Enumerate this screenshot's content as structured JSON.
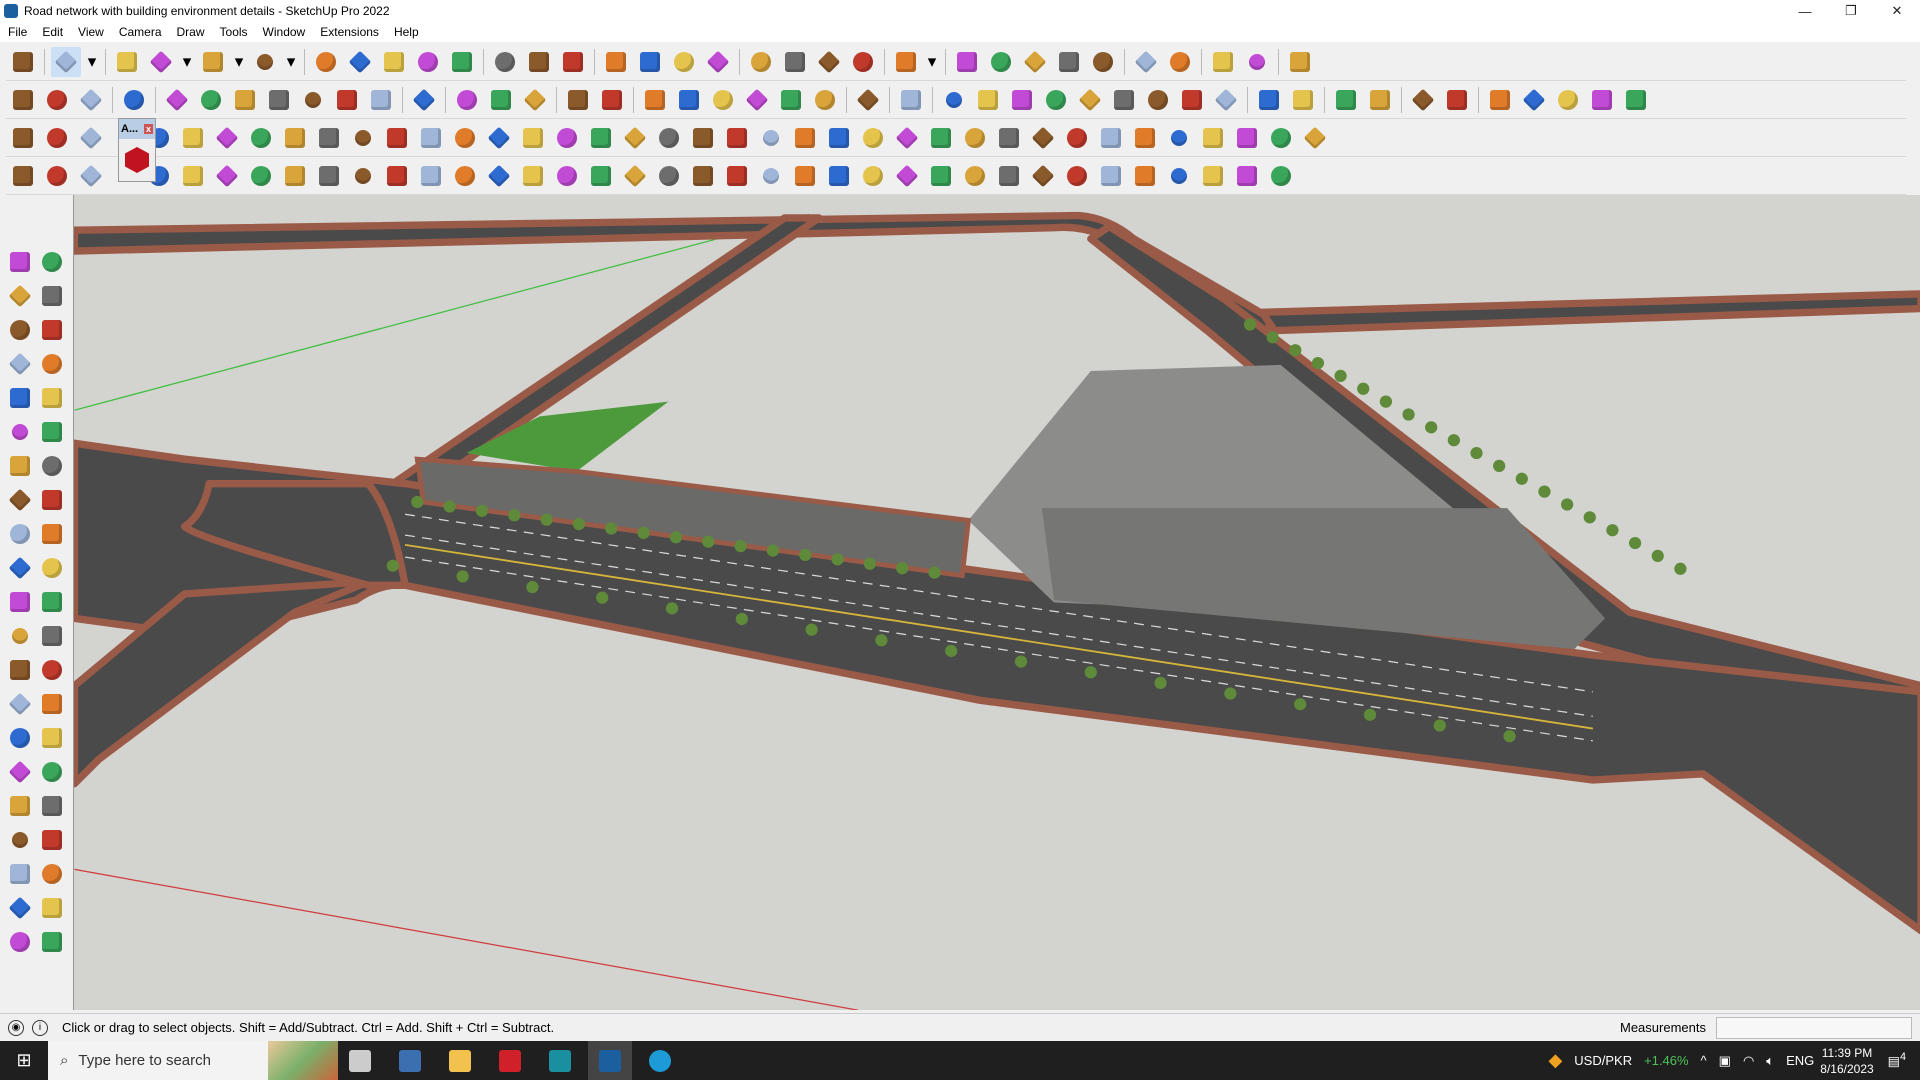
{
  "window": {
    "title": "Road network with building environment details - SketchUp Pro 2022",
    "controls": [
      "—",
      "❐",
      "✕"
    ]
  },
  "menu": [
    "File",
    "Edit",
    "View",
    "Camera",
    "Draw",
    "Tools",
    "Window",
    "Extensions",
    "Help"
  ],
  "toolbars": {
    "row1": [
      "zoom-icon",
      "|",
      "select-icon",
      "dropdown-icon",
      "|",
      "eraser-icon",
      "pencil-icon",
      "dropdown-icon",
      "arc-icon",
      "dropdown-icon",
      "rectangle-icon",
      "dropdown-icon",
      "|",
      "push-pull-icon",
      "follow-me-icon",
      "move-icon",
      "rotate-icon",
      "scale-icon",
      "|",
      "tape-measure-icon",
      "text-icon",
      "paint-bucket-icon",
      "|",
      "orbit-icon",
      "pan-icon",
      "zoom-tool-icon",
      "zoom-extents-icon",
      "|",
      "components-icon",
      "styles-icon",
      "layers-icon",
      "scenes-icon",
      "|",
      "user-icon",
      "dropdown-icon",
      "|",
      "export-icon",
      "import-icon",
      "up-icon",
      "sort-up-icon",
      "sort-down-icon",
      "|",
      "measure-icon",
      "section-icon",
      "|",
      "undo-icon",
      "redo-icon",
      "|",
      "hand-icon"
    ],
    "row2": [
      "solid-union-icon",
      "solid-trim-icon",
      "solid-split-icon",
      "|",
      "joint-pushpull-icon",
      "|",
      "pushpull-normal-icon",
      "pushpull-joint-icon",
      "pushpull-round-icon",
      "pushpull-vector-icon",
      "pushpull-n-icon",
      "pushpull-x-icon",
      "pushpull-f-icon",
      "|",
      "curviloft-icon",
      "|",
      "slice-icon",
      "slice-icon",
      "slice-icon",
      "|",
      "sandbox-icon",
      "sandbox-drape-icon",
      "|",
      "house-icon",
      "wall-icon",
      "home-icon",
      "roof-icon",
      "outline-house-icon",
      "garage-icon",
      "|",
      "function-icon",
      "|",
      "leaf-icon",
      "|",
      "ruler-icon",
      "rect-shape-icon",
      "circle-shape-icon",
      "hexagon-shape-icon",
      "ellipse-shape-icon",
      "parallelogram-shape-icon",
      "arc-shape-icon",
      "spiral-shape-icon",
      "polygon-shape-icon",
      "|",
      "loop-icon",
      "gear-icon",
      "|",
      "line-red-icon",
      "eraser-pink-icon",
      "|",
      "cube-brown-icon",
      "grid-brown-icon",
      "|",
      "brick-icon",
      "stone-icon",
      "round-icon",
      "block-icon",
      "box-icon"
    ],
    "row3": [
      "plane-hash-icon",
      "plane-blue-icon",
      "plane-yellow-icon",
      "gap",
      "grid-red-icon",
      "grid-outline-icon",
      "rotate-orange-icon",
      "square-red-icon",
      "columns-icon",
      "flag-icon",
      "wood-icon",
      "pipe-icon",
      "bend-icon",
      "points-icon",
      "cross-red-icon",
      "cross-green-icon",
      "x-blue-icon",
      "drop-icon",
      "drop-hash-icon",
      "triangle-icon",
      "loop-orange-icon",
      "loop-red-icon",
      "loop-black-icon",
      "star-icon",
      "bucket-icon",
      "magnet-icon",
      "tree-icon",
      "array-icon",
      "copy-icon",
      "duplicate-icon",
      "gem-icon",
      "flower-icon",
      "film-icon",
      "grid-orange-icon",
      "grid-yellow-icon",
      "grid-gold-icon",
      "scatter-icon",
      "curve-icon",
      "qr-icon"
    ],
    "row4": [
      "poly-icon",
      "dots-icon",
      "cube-red-icon",
      "gap",
      "sphere-icon",
      "box-outline-icon",
      "bend-shape-icon",
      "dome-icon",
      "helmet-icon",
      "cube-outline-icon",
      "corner-icon",
      "corner2-icon",
      "angle-icon",
      "wedge-icon",
      "frame-icon",
      "tent-icon",
      "pillars-icon",
      "fingers-icon",
      "ring-icon",
      "panel-icon",
      "arrow-icon",
      "lines-icon",
      "slash-icon",
      "scissors-icon",
      "scissors2-icon",
      "tile-icon",
      "stairs-icon",
      "step-icon",
      "step2-icon",
      "bars-icon",
      "hatch-icon",
      "hatch2-icon",
      "fence-icon",
      "wheel-icon",
      "wheel2-icon",
      "ramp-icon",
      "truss-icon",
      "roof2-icon"
    ],
    "left": [
      "select-icon",
      "orbit-icon",
      "paint-bucket-icon",
      "eraser-icon",
      "component-icon",
      "tag-icon",
      "line-icon",
      "freehand-icon",
      "rectangle-icon",
      "rotated-rect-icon",
      "circle-icon",
      "polygon-icon",
      "arc-icon",
      "pie-icon",
      "arc2-icon",
      "arc3-icon",
      "move-icon",
      "push-pull-icon",
      "rotate-icon",
      "follow-me-icon",
      "scale-icon",
      "offset-icon",
      "tape-measure-icon",
      "dimension-icon",
      "protractor-icon",
      "text-icon",
      "axes-icon",
      "3d-text-icon",
      "orbit-tool-icon",
      "pan-icon",
      "zoom-icon",
      "zoom-window-icon",
      "zoom-extents-icon",
      "previous-view-icon",
      "position-camera-icon",
      "look-around-icon",
      "walk-icon",
      "section-plane-icon",
      "components-icon",
      "styles-icon",
      "layers-icon",
      "scenes-icon"
    ]
  },
  "mini_toolbar": {
    "title": "A...",
    "close": "x"
  },
  "palette": [
    "#d9a43a",
    "#c0392b",
    "#2e6bd1",
    "#3aa65b",
    "#8b5a2b",
    "#e07b2a",
    "#c24bd6",
    "#6d6d6d",
    "#9fb6d9",
    "#e4c44c"
  ],
  "status": {
    "hint": "Click or drag to select objects. Shift = Add/Subtract. Ctrl = Add. Shift + Ctrl = Subtract.",
    "measurements_label": "Measurements",
    "measurements_value": ""
  },
  "taskbar": {
    "search_placeholder": "Type here to search",
    "apps": [
      "task-view-icon",
      "calculator-icon",
      "file-explorer-icon",
      "autocad-icon",
      "3ds-max-icon",
      "sketchup-icon",
      "edge-icon"
    ],
    "ticker": "USD/PKR",
    "ticker_change": "+1.46%",
    "language": "ENG",
    "time": "11:39 PM",
    "date": "8/16/2023",
    "notifications": "4"
  }
}
